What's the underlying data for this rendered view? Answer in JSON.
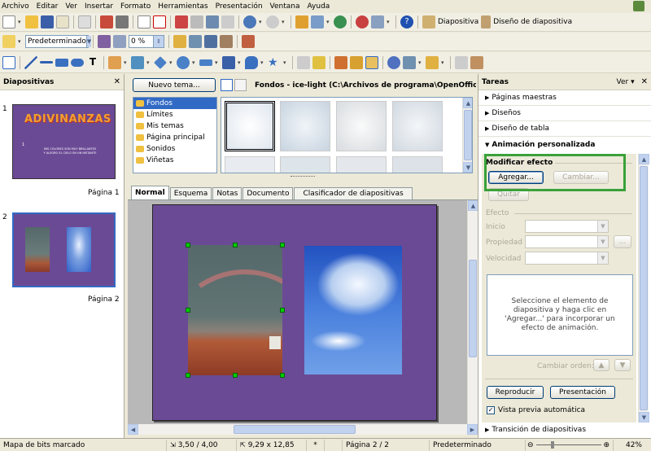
{
  "menu": [
    "Archivo",
    "Editar",
    "Ver",
    "Insertar",
    "Formato",
    "Herramientas",
    "Presentación",
    "Ventana",
    "Ayuda"
  ],
  "toolbar1": {
    "diapositiva_label": "Diapositiva",
    "diseno_label": "Diseño de diapositiva"
  },
  "toolbar2": {
    "style_value": "Predeterminado",
    "transparency_value": "0 %"
  },
  "slides_panel": {
    "title": "Diapositivas",
    "slides": [
      {
        "number": "1",
        "label": "Página 1",
        "title_text": "ADIVINANZAS",
        "bullet": "1",
        "body_text": "MIS COLORES SON MUY BRILLANTES\nY ALEGRO EL CIELO EN UN INSTANTE"
      },
      {
        "number": "2",
        "label": "Página 2"
      }
    ]
  },
  "gallery": {
    "new_theme_label": "Nuevo tema...",
    "path_title": "Fondos - ice-light (C:\\Archivos de programa\\OpenOffice.org",
    "themes": [
      "Fondos",
      "Límites",
      "Mis temas",
      "Página principal",
      "Sonidos",
      "Viñetas"
    ],
    "selected_theme": "Fondos"
  },
  "view_tabs": [
    "Normal",
    "Esquema",
    "Notas",
    "Documento",
    "Clasificador de diapositivas"
  ],
  "tasks": {
    "title": "Tareas",
    "view_label": "Ver",
    "sections": [
      "Páginas maestras",
      "Diseños",
      "Diseño de tabla"
    ],
    "active_section": "Animación personalizada",
    "modify_effect_label": "Modificar efecto",
    "add_button": "Agregar...",
    "change_button": "Cambiar...",
    "remove_button": "Quitar",
    "effect_label": "Efecto",
    "start_label": "Inicio",
    "property_label": "Propiedad",
    "speed_label": "Velocidad",
    "ellipsis_button": "...",
    "info_text": "Seleccione el elemento de diapositiva y haga clic en 'Agregar...' para incorporar un efecto de animación.",
    "change_order_label": "Cambiar orden:",
    "play_button": "Reproducir",
    "presentation_button": "Presentación",
    "auto_preview_label": "Vista previa automática",
    "transition_label": "Transición de diapositivas"
  },
  "status": {
    "message": "Mapa de bits marcado",
    "position": "3,50 / 4,00",
    "size": "9,29 x 12,85",
    "modified": "*",
    "page": "Página 2 / 2",
    "master": "Predeterminado",
    "zoom": "42%"
  },
  "colors": {
    "slide_purple": "#6b4a95",
    "highlight_green": "#3aa13a",
    "selection_blue": "#316ac5"
  }
}
